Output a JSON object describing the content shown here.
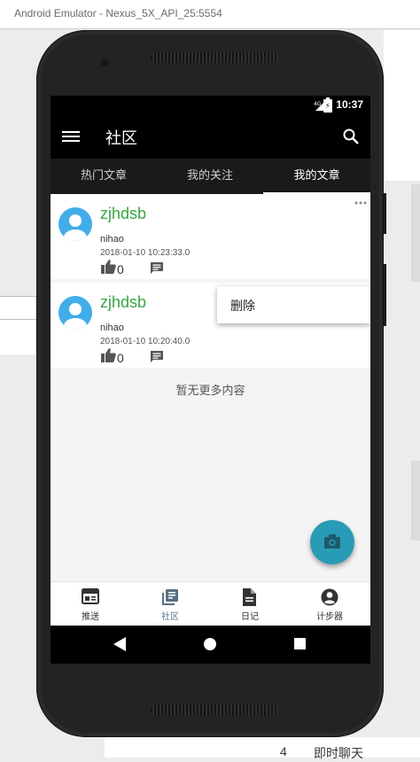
{
  "window": {
    "title": "Android Emulator - Nexus_5X_API_25:5554"
  },
  "status_bar": {
    "network": "4G",
    "time": "10:37"
  },
  "toolbar": {
    "title": "社区",
    "menu_icon": "hamburger-menu-icon",
    "search_icon": "search-icon"
  },
  "tabs": [
    {
      "label": "热门文章",
      "active": false
    },
    {
      "label": "我的关注",
      "active": false
    },
    {
      "label": "我的文章",
      "active": true
    }
  ],
  "posts": [
    {
      "author": "zjhdsb",
      "content": "nihao",
      "time": "2018-01-10 10:23:33.0",
      "likes": "0"
    },
    {
      "author": "zjhdsb",
      "content": "nihao",
      "time": "2018-01-10 10:20:40.0",
      "likes": "0"
    }
  ],
  "popup_menu": {
    "items": [
      "删除"
    ]
  },
  "list_footer": "暂无更多内容",
  "fab": {
    "icon": "camera-icon"
  },
  "bottom_nav": [
    {
      "label": "推送",
      "icon": "newspaper-icon",
      "active": false
    },
    {
      "label": "社区",
      "icon": "library-books-icon",
      "active": true
    },
    {
      "label": "日记",
      "icon": "document-icon",
      "active": false
    },
    {
      "label": "计步器",
      "icon": "account-circle-icon",
      "active": false
    }
  ],
  "background_fragments": [
    "4",
    "即时聊天"
  ],
  "colors": {
    "accent_green": "#3aa644",
    "avatar_blue": "#41aee9",
    "fab_teal": "#2a9bb6",
    "toolbar_black": "#000000"
  }
}
